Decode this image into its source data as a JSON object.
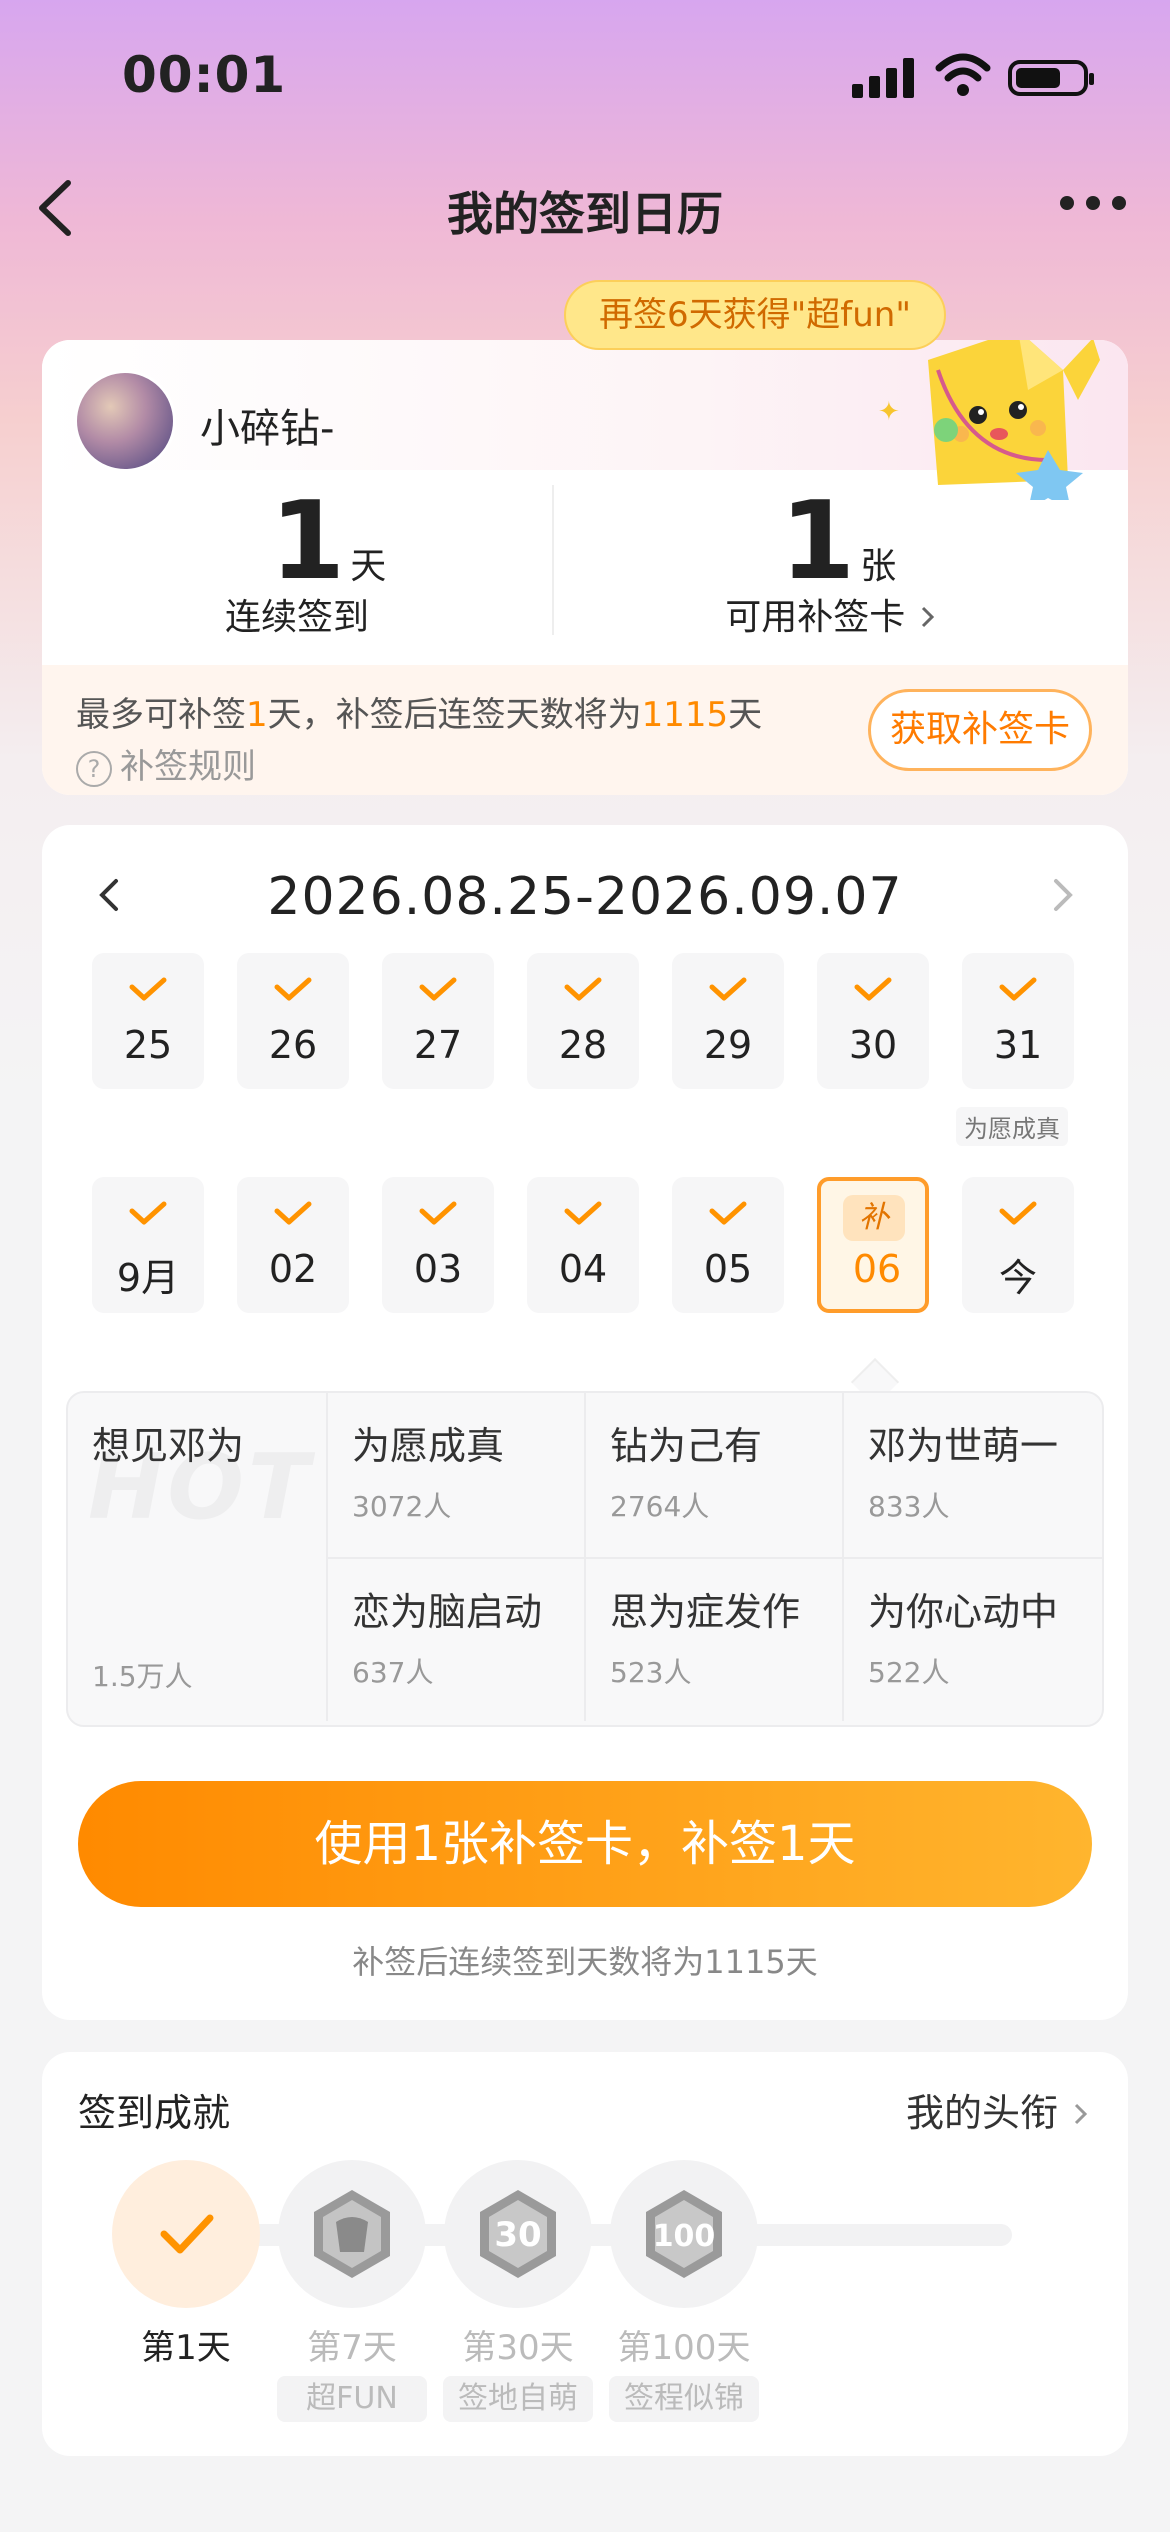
{
  "status": {
    "time": "00:01"
  },
  "nav": {
    "title": "我的签到日历",
    "bubble": "再签6天获得\"超fun\""
  },
  "user": {
    "name": "小碎钻-"
  },
  "stats": {
    "streak": {
      "value": "1",
      "unit": "天",
      "label": "连续签到"
    },
    "cards": {
      "value": "1",
      "unit": "张",
      "label": "可用补签卡"
    }
  },
  "info": {
    "text_prefix": "最多可补签",
    "days": "1",
    "text_mid": "天，补签后连签天数将为",
    "total": "1115",
    "text_suffix": "天",
    "rule": "补签规则",
    "button": "获取补签卡"
  },
  "calendar": {
    "range": "2026.08.25-2026.09.07",
    "row1": [
      "25",
      "26",
      "27",
      "28",
      "29",
      "30",
      "31"
    ],
    "row2": [
      "9月",
      "02",
      "03",
      "04",
      "05",
      "06",
      "今"
    ],
    "selected_badge": "补",
    "note_31": "为愿成真"
  },
  "hot": {
    "main": {
      "title": "想见邓为",
      "count": "1.5万人",
      "watermark": "HOT"
    },
    "items": [
      {
        "title": "为愿成真",
        "count": "3072人"
      },
      {
        "title": "钻为己有",
        "count": "2764人"
      },
      {
        "title": "邓为世萌一",
        "count": "833人"
      },
      {
        "title": "恋为脑启动",
        "count": "637人"
      },
      {
        "title": "思为症发作",
        "count": "523人"
      },
      {
        "title": "为你心动中",
        "count": "522人"
      }
    ]
  },
  "action": {
    "button": "使用1张补签卡，补签1天",
    "note": "补签后连续签到天数将为1115天"
  },
  "achievements": {
    "title": "签到成就",
    "link": "我的头衔",
    "items": [
      {
        "label": "第1天",
        "tag": ""
      },
      {
        "label": "第7天",
        "tag": "超FUN"
      },
      {
        "label": "第30天",
        "tag": "签地自萌"
      },
      {
        "label": "第100天",
        "tag": "签程似锦"
      }
    ]
  },
  "colors": {
    "accent": "#ff8a00",
    "accent_light": "#ffb52e",
    "text": "#222222",
    "muted": "#999999"
  }
}
